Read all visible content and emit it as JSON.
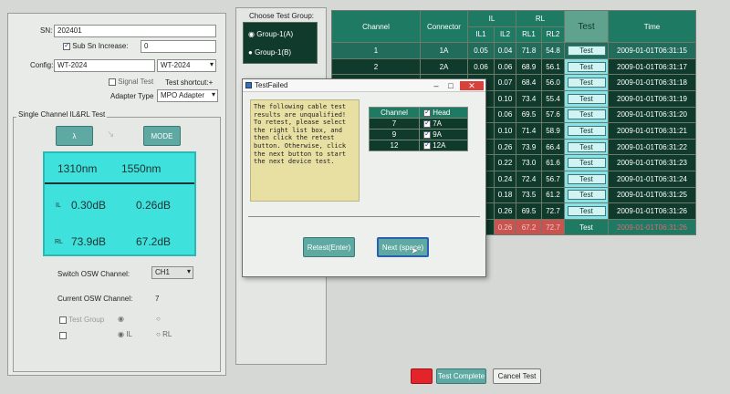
{
  "left": {
    "sn_label": "SN:",
    "sn_value": "202401",
    "sub_sn_label": "Sub Sn Increase:",
    "sub_sn_value": "0",
    "config_label": "Config:",
    "config_value": "WT-2024",
    "config_select": "WT-2024",
    "signal_test_label": "Signal Test",
    "test_shortcut_label": "Test shortcut:+",
    "adapter_type_label": "Adapter Type",
    "adapter_type_value": "MPO Adapter",
    "single_channel_label": "Single Channel IL&RL Test",
    "lambda_button": "λ",
    "mode_button": "MODE",
    "wl1": "1310nm",
    "wl2": "1550nm",
    "il_label": "IL",
    "il1": "0.30dB",
    "il2": "0.26dB",
    "rl_label": "RL",
    "rl1": "73.9dB",
    "rl2": "67.2dB",
    "switch_osw_label": "Switch OSW Channel:",
    "switch_osw_value": "CH1",
    "current_osw_label": "Current OSW Channel:",
    "current_osw_value": "7",
    "test_group_label": "Test Group",
    "il_radio_label": "IL",
    "rl_radio_label": "RL"
  },
  "groups": {
    "title": "Choose Test Group:",
    "items": [
      "Group-1(A)",
      "Group-1(B)"
    ]
  },
  "table": {
    "headers": {
      "channel": "Channel",
      "connector": "Connector",
      "il": "IL",
      "rl": "RL",
      "test": "Test",
      "time": "Time",
      "il1": "IL1",
      "il2": "IL2",
      "rl1": "RL1",
      "rl2": "RL2"
    },
    "rows": [
      {
        "ch": "1",
        "conn": "1A",
        "il1": "0.05",
        "il2": "0.04",
        "rl1": "71.8",
        "rl2": "54.8",
        "test": "Test",
        "time": "2009-01-01T06:31:15"
      },
      {
        "ch": "2",
        "conn": "2A",
        "il1": "0.06",
        "il2": "0.06",
        "rl1": "68.9",
        "rl2": "56.1",
        "test": "Test",
        "time": "2009-01-01T06:31:17"
      },
      {
        "ch": "",
        "conn": "",
        "il1": "",
        "il2": "0.07",
        "rl1": "68.4",
        "rl2": "56.0",
        "test": "Test",
        "time": "2009-01-01T06:31:18"
      },
      {
        "ch": "",
        "conn": "",
        "il1": "",
        "il2": "0.10",
        "rl1": "73.4",
        "rl2": "55.4",
        "test": "Test",
        "time": "2009-01-01T06:31:19"
      },
      {
        "ch": "",
        "conn": "",
        "il1": "",
        "il2": "0.06",
        "rl1": "69.5",
        "rl2": "57.6",
        "test": "Test",
        "time": "2009-01-01T06:31:20"
      },
      {
        "ch": "",
        "conn": "",
        "il1": "",
        "il2": "0.10",
        "rl1": "71.4",
        "rl2": "58.9",
        "test": "Test",
        "time": "2009-01-01T06:31:21"
      },
      {
        "ch": "",
        "conn": "",
        "il1": "",
        "il2": "0.26",
        "rl1": "73.9",
        "rl2": "66.4",
        "test": "Test",
        "time": "2009-01-01T06:31:22"
      },
      {
        "ch": "",
        "conn": "",
        "il1": "",
        "il2": "0.22",
        "rl1": "73.0",
        "rl2": "61.6",
        "test": "Test",
        "time": "2009-01-01T06:31:23"
      },
      {
        "ch": "",
        "conn": "",
        "il1": "",
        "il2": "0.24",
        "rl1": "72.4",
        "rl2": "56.7",
        "test": "Test",
        "time": "2009-01-01T06:31:24"
      },
      {
        "ch": "",
        "conn": "",
        "il1": "",
        "il2": "0.18",
        "rl1": "73.5",
        "rl2": "61.2",
        "test": "Test",
        "time": "2009-01-01T06:31:25"
      },
      {
        "ch": "",
        "conn": "",
        "il1": "",
        "il2": "0.26",
        "rl1": "69.5",
        "rl2": "72.7",
        "test": "Test",
        "time": "2009-01-01T06:31:26"
      },
      {
        "ch": "",
        "conn": "",
        "il1": "",
        "il2": "0.26",
        "rl1": "67.2",
        "rl2": "72.7",
        "test": "Test",
        "time": "2009-01-01T06:31:26"
      }
    ]
  },
  "dialog": {
    "title": "TestFailed",
    "message": "The following cable test results are unqualified! To retest, please select the right list box, and then click the retest button. Otherwise, click the next button to start the next device test.",
    "channel_header": "Channel",
    "head_header": "Head",
    "rows": [
      {
        "channel": "7",
        "head": "7A"
      },
      {
        "channel": "9",
        "head": "9A"
      },
      {
        "channel": "12",
        "head": "12A"
      }
    ],
    "retest_button": "Retest(Enter)",
    "next_button": "Next (space)"
  },
  "footer": {
    "test_complete_button": "Test Complete",
    "cancel_test_button": "Cancel Test"
  },
  "colors": {
    "table_header": "#1f7a63",
    "table_cell": "#0f3a2c",
    "readout": "#3ee1dc",
    "stop_button": "#e3242b",
    "note_background": "#e8dfa3"
  }
}
